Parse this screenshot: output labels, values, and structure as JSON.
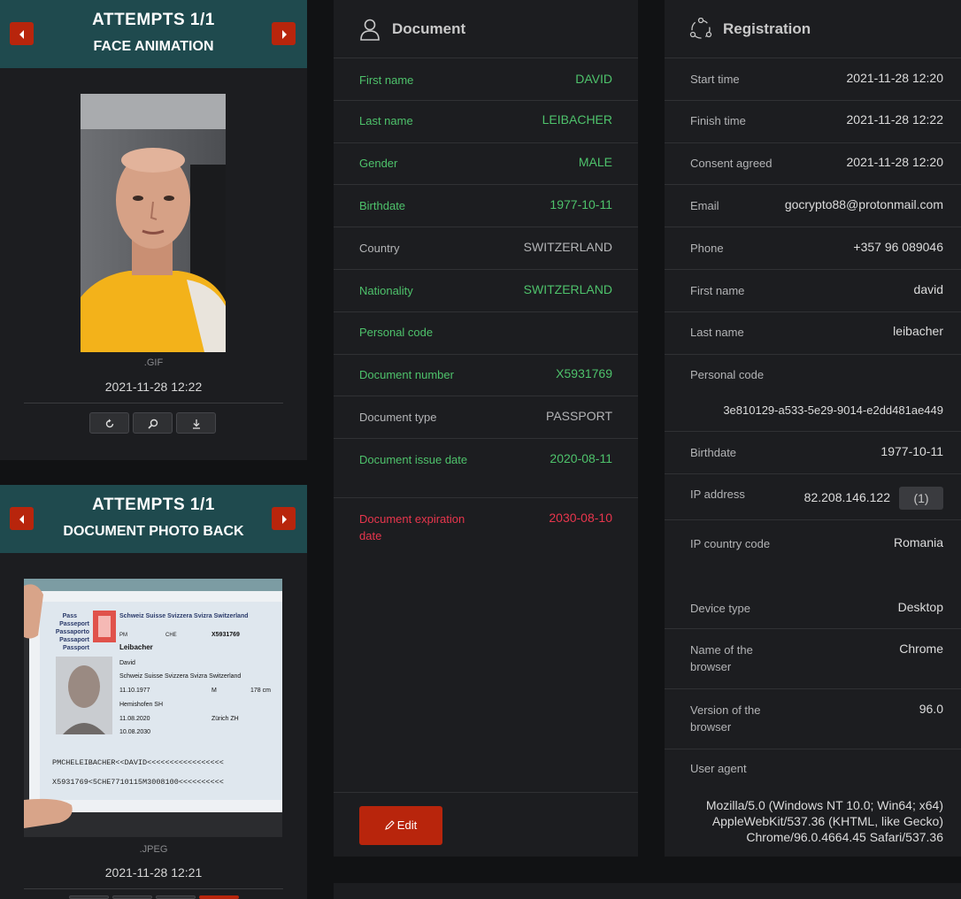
{
  "face_card": {
    "attempts": "ATTEMPTS 1/1",
    "title": "FACE ANIMATION",
    "prev_icon": "chevron-left-icon",
    "next_icon": "chevron-right-icon",
    "file_ext": ".GIF",
    "timestamp": "2021-11-28 12:22",
    "tools": [
      "rotate-icon",
      "zoom-icon",
      "download-icon"
    ]
  },
  "back_card": {
    "attempts": "ATTEMPTS 1/1",
    "title": "DOCUMENT PHOTO BACK",
    "file_ext": ".JPEG",
    "timestamp": "2021-11-28 12:21"
  },
  "document": {
    "title": "Document",
    "icon": "user-icon",
    "rows": [
      {
        "label": "First name",
        "value": "DAVID",
        "state": "green"
      },
      {
        "label": "Last name",
        "value": "LEIBACHER",
        "state": "green"
      },
      {
        "label": "Gender",
        "value": "MALE",
        "state": "green"
      },
      {
        "label": "Birthdate",
        "value": "1977-10-11",
        "state": "green"
      },
      {
        "label": "Country",
        "value": "SWITZERLAND",
        "state": "gray"
      },
      {
        "label": "Nationality",
        "value": "SWITZERLAND",
        "state": "green"
      },
      {
        "label": "Personal code",
        "value": "",
        "state": "green"
      },
      {
        "label": "Document number",
        "value": "X5931769",
        "state": "green"
      },
      {
        "label": "Document type",
        "value": "PASSPORT",
        "state": "gray"
      },
      {
        "label": "Document issue date",
        "value": "2020-08-11",
        "state": "green"
      },
      {
        "label": "Document expiration date",
        "value": "2030-08-10",
        "state": "red"
      }
    ],
    "edit_label": "Edit",
    "edit_icon": "pencil-icon"
  },
  "registration": {
    "title": "Registration",
    "icon": "share-nodes-icon",
    "start_label": "Start time",
    "start_value": "2021-11-28 12:20",
    "finish_label": "Finish time",
    "finish_value": "2021-11-28 12:22",
    "consent_label": "Consent agreed",
    "consent_value": "2021-11-28 12:20",
    "email_label": "Email",
    "email_value": "gocrypto88@protonmail.com",
    "phone_label": "Phone",
    "phone_value": "+357 96 089046",
    "first_label": "First name",
    "first_value": "david",
    "last_label": "Last name",
    "last_value": "leibacher",
    "pcode_label": "Personal code",
    "pcode_value": "3e810129-a533-5e29-9014-e2dd481ae449",
    "birth_label": "Birthdate",
    "birth_value": "1977-10-11",
    "ip_label": "IP address",
    "ip_value": "82.208.146.122",
    "ip_count": "(1)",
    "ipcc_label": "IP country code",
    "ipcc_value": "Romania",
    "device_label": "Device type",
    "device_value": "Desktop",
    "browser_label": "Name of the browser",
    "browser_value": "Chrome",
    "version_label": "Version of the browser",
    "version_value": "96.0",
    "ua_label": "User agent",
    "ua_line1": "Mozilla/5.0 (Windows NT 10.0; Win64; x64)",
    "ua_line2": "AppleWebKit/537.36 (KHTML, like Gecko)",
    "ua_line3": "Chrome/96.0.4664.45 Safari/537.36"
  },
  "passport_text": {
    "country_line": "Schweiz Suisse Svizzera Svizra Switzerland",
    "pass_words": [
      "Pass",
      "Passeport",
      "Passaporto",
      "Passaport",
      "Passport"
    ],
    "type": "PM",
    "code": "CHE",
    "number": "X5931769",
    "surname": "Leibacher",
    "given": "David",
    "nationality": "Schweiz Suisse Svizzera Svizra Switzerland",
    "dob": "11.10.1977",
    "sex": "M",
    "height": "178 cm",
    "origin": "Hemishofen SH",
    "issue": "11.08.2020",
    "authority": "Zürich ZH",
    "expiry": "10.08.2030",
    "mrz1": "PMCHELEIBACHER<<DAVID<<<<<<<<<<<<<<<<<",
    "mrz2": "X5931769<5CHE7710115M3008100<<<<<<<<<<"
  }
}
